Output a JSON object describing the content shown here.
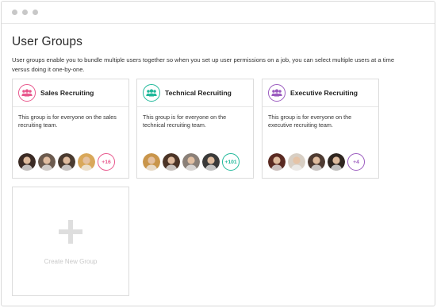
{
  "header": {
    "title": "User Groups",
    "description": "User groups enable you to bundle multiple users together so when you set up user permissions on a job, you can select multiple users at a time versus doing it one-by-one."
  },
  "groups": [
    {
      "name": "Sales Recruiting",
      "description": "This group is for everyone on the sales recruiting team.",
      "accent": "#e8588d",
      "more_count": "+16",
      "avatars": [
        "#3a2a24",
        "#6b5a4e",
        "#4a3b30",
        "#d9a85a"
      ]
    },
    {
      "name": "Technical Recruiting",
      "description": "This group is for everyone on the technical recruiting team.",
      "accent": "#1fb89a",
      "more_count": "+101",
      "avatars": [
        "#c9954a",
        "#4b3427",
        "#8a8078",
        "#3a3a3a"
      ]
    },
    {
      "name": "Executive Recruiting",
      "description": "This group is for everyone on the executive recruiting team.",
      "accent": "#9b5bbf",
      "more_count": "+4",
      "avatars": [
        "#5a2a22",
        "#d8cfc4",
        "#4e3b32",
        "#2f2620"
      ]
    }
  ],
  "create": {
    "label": "Create New Group"
  }
}
